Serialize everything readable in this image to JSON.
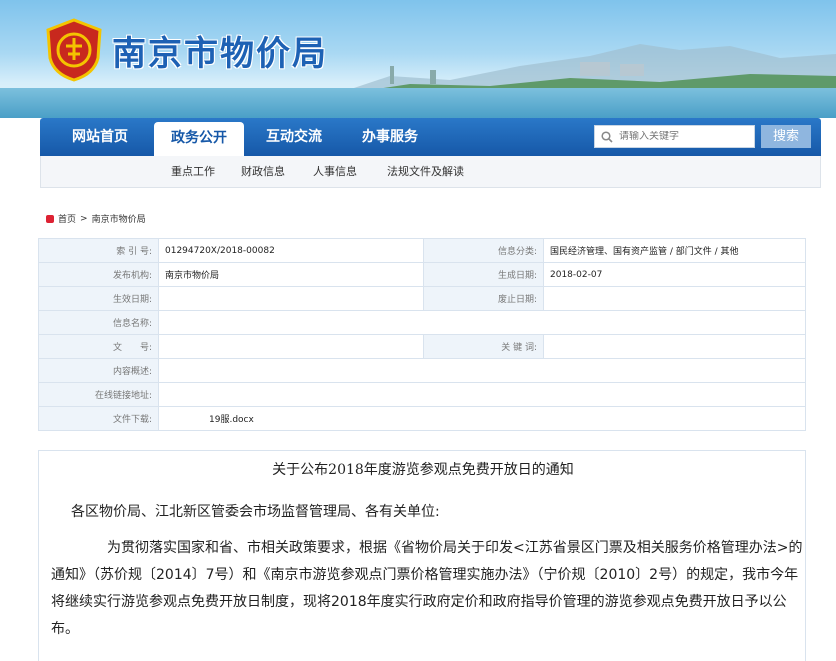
{
  "header": {
    "site_title": "南京市物价局"
  },
  "nav": {
    "items": [
      {
        "label": "网站首页"
      },
      {
        "label": "政务公开"
      },
      {
        "label": "互动交流"
      },
      {
        "label": "办事服务"
      }
    ],
    "search_placeholder": "请输入关键字",
    "search_button": "搜索"
  },
  "subnav": {
    "items": [
      {
        "label": "重点工作"
      },
      {
        "label": "财政信息"
      },
      {
        "label": "人事信息"
      },
      {
        "label": "法规文件及解读"
      }
    ]
  },
  "breadcrumb": {
    "home": "首页",
    "separator": ">",
    "current": "南京市物价局"
  },
  "info": {
    "index_label": "索 引 号:",
    "index_value": "01294720X/2018-00082",
    "category_label": "信息分类:",
    "category_value": "国民经济管理、国有资产监管 / 部门文件 / 其他",
    "publisher_label": "发布机构:",
    "publisher_value": "南京市物价局",
    "created_label": "生成日期:",
    "created_value": "2018-02-07",
    "effective_label": "生效日期:",
    "effective_value": "",
    "expiry_label": "废止日期:",
    "expiry_value": "",
    "name_label": "信息名称:",
    "name_value": "",
    "docno_label": "文　　号:",
    "docno_value": "",
    "keywords_label": "关 键 词:",
    "keywords_value": "",
    "summary_label": "内容概述:",
    "summary_value": "",
    "link_label": "在线链接地址:",
    "link_value": "",
    "download_label": "文件下载:",
    "download_value": "19服.docx"
  },
  "article": {
    "title": "关于公布2018年度游览参观点免费开放日的通知",
    "salutation": "各区物价局、江北新区管委会市场监督管理局、各有关单位:",
    "body": "为贯彻落实国家和省、市相关政策要求，根据《省物价局关于印发<江苏省景区门票及相关服务价格管理办法>的通知》（苏价规〔2014〕7号）和《南京市游览参观点门票价格管理实施办法》（宁价规〔2010〕2号）的规定，我市今年将继续实行游览参观点免费开放日制度，现将2018年度实行政府定价和政府指导价管理的游览参观点免费开放日予以公布。"
  },
  "colors": {
    "nav_blue": "#1658a8",
    "title_blue": "#1d61b4",
    "logo_red": "#c8281e"
  }
}
